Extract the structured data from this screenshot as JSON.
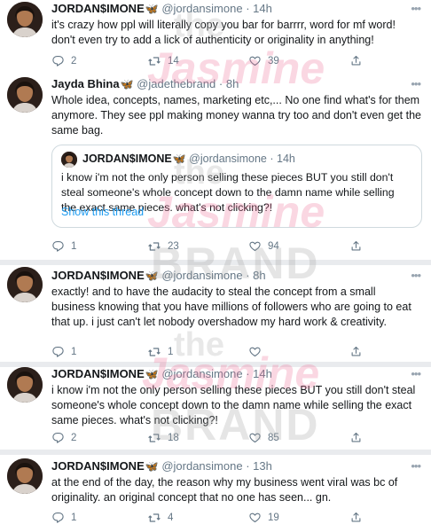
{
  "tweets": [
    {
      "name": "JORDAN$IMONE",
      "handle": "@jordansimone",
      "dot": "·",
      "time": "14h",
      "text": "it's crazy how ppl will literally copy you bar for barrrr, word for mf word! don't even try to add a lick of authenticity or originality in anything!",
      "replies": "2",
      "retweets": "14",
      "likes": "39"
    },
    {
      "name": "Jayda Bhina",
      "handle": "@jadethebrand",
      "dot": "·",
      "time": "8h",
      "text": "Whole idea, concepts, names, marketing etc,... No one find what's for them anymore. They see ppl making money wanna try too and don't even get the same bag.",
      "quote": {
        "name": "JORDAN$IMONE",
        "handle": "@jordansimone",
        "dot": "·",
        "time": "14h",
        "text": "i know i'm not the only person selling these pieces BUT you still don't steal someone's whole concept down to the damn name while selling the exact same pieces. what's not clicking?!",
        "link": "Show this thread"
      },
      "replies": "1",
      "retweets": "23",
      "likes": "94"
    },
    {
      "name": "JORDAN$IMONE",
      "handle": "@jordansimone",
      "dot": "·",
      "time": "8h",
      "text": "exactly! and to have the audacity to steal the concept from a small business knowing that you have millions of followers who are going to eat that up. i just can't let nobody overshadow my hard work & creativity.",
      "replies": "1",
      "retweets": "1",
      "likes": ""
    },
    {
      "name": "JORDAN$IMONE",
      "handle": "@jordansimone",
      "dot": "·",
      "time": "14h",
      "text": "i know i'm not the only person selling these pieces BUT you still don't steal someone's whole concept down to the damn name while selling the exact same pieces. what's not clicking?!",
      "replies": "2",
      "retweets": "18",
      "likes": "85"
    },
    {
      "name": "JORDAN$IMONE",
      "handle": "@jordansimone",
      "dot": "·",
      "time": "13h",
      "text": "at the end of the day, the reason why my business went viral was bc of originality. an original concept that no one has seen... gn.",
      "replies": "1",
      "retweets": "4",
      "likes": "19"
    }
  ],
  "watermark": {
    "the": "the",
    "jasmine": "Jasmine",
    "brand": "BRAND"
  },
  "icons": {
    "reply": "reply-icon",
    "retweet": "retweet-icon",
    "like": "heart-icon",
    "share": "share-icon",
    "more": "more-icon",
    "verified_butterfly": "butterfly-icon"
  },
  "colors": {
    "link": "#1d9bf0",
    "muted": "#657786",
    "butterfly": "#3b82f6",
    "separator": "#e9ebee"
  }
}
